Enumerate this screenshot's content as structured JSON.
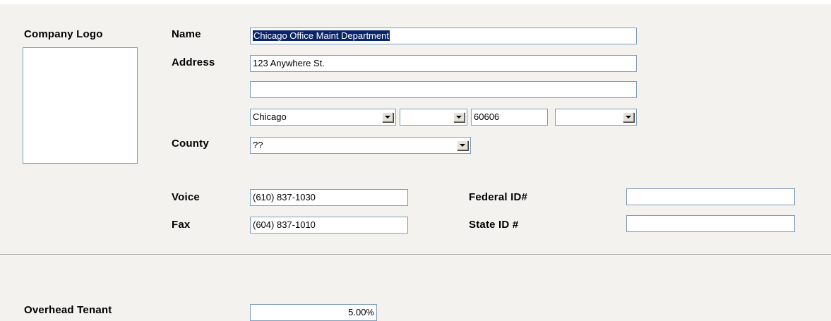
{
  "logo": {
    "label": "Company Logo"
  },
  "labels": {
    "name": "Name",
    "address": "Address",
    "county": "County",
    "voice": "Voice",
    "fax": "Fax",
    "federal_id": "Federal ID#",
    "state_id": "State ID #",
    "overhead_tenant": "Overhead Tenant"
  },
  "fields": {
    "name": "Chicago Office Maint Department",
    "address1": "123 Anywhere St.",
    "address2": "",
    "city": "Chicago",
    "state": "",
    "zip": "60606",
    "zip_ext": "",
    "county": "??",
    "voice": "(610) 837-1030",
    "fax": "(604) 837-1010",
    "federal_id": "",
    "state_id": "",
    "overhead_tenant": "5.00%"
  },
  "icons": {
    "dropdown": "chevron-down-icon"
  }
}
